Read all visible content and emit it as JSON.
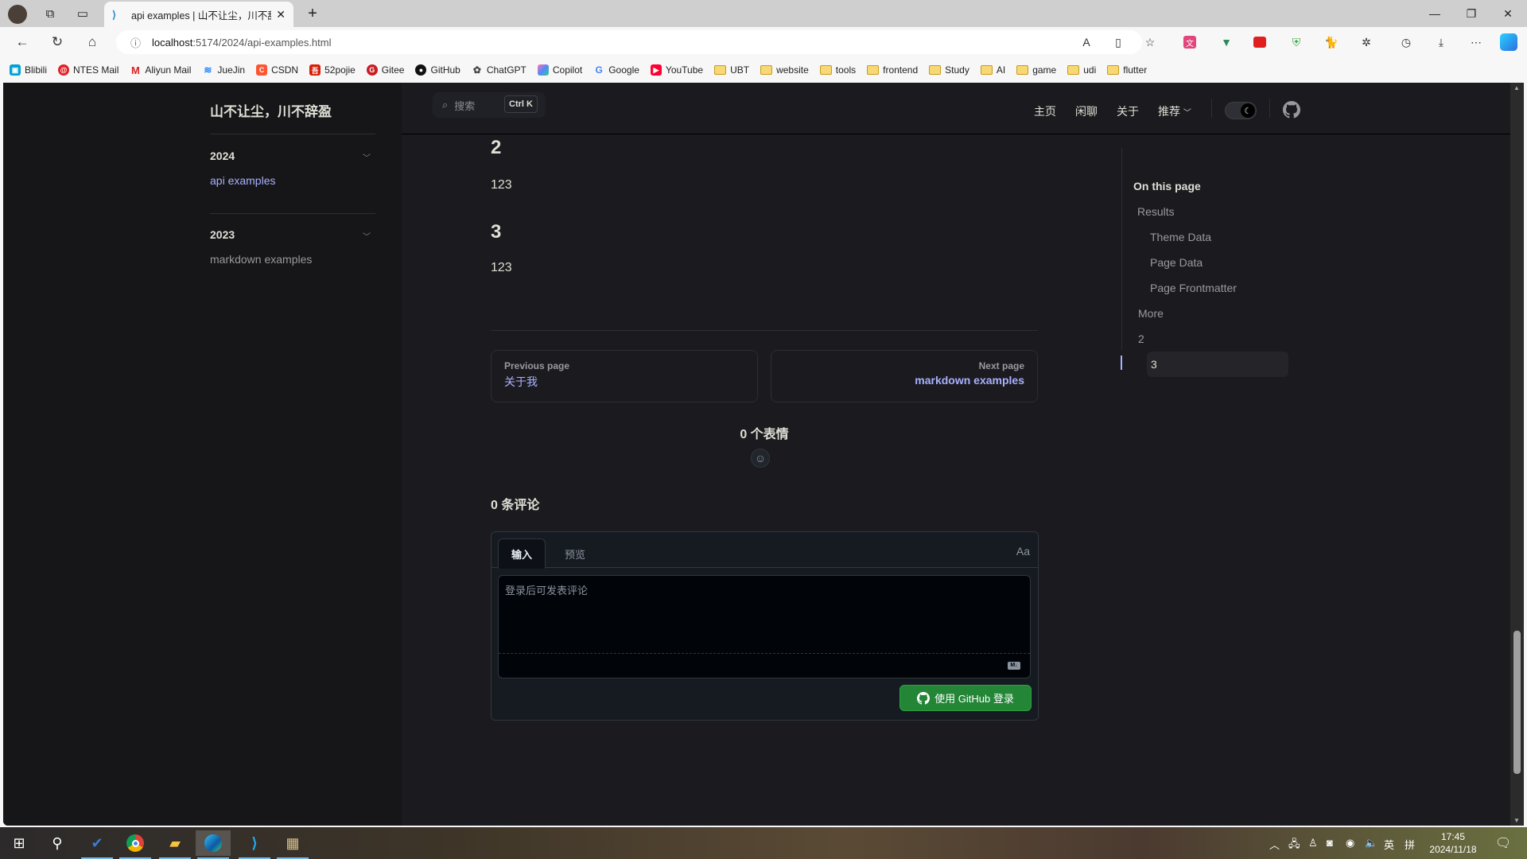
{
  "browser": {
    "tab_title": "api examples | 山不让尘，川不辞盈",
    "new_tab_symbol": "+",
    "url_host": "localhost",
    "url_path": ":5174/2024/api-examples.html",
    "bookmarks": [
      {
        "label": "Blibili",
        "icon": "bilibili-icon",
        "color": "#00a1d6"
      },
      {
        "label": "NTES Mail",
        "icon": "netease-mail-icon",
        "color": "#e31e24"
      },
      {
        "label": "Aliyun Mail",
        "icon": "aliyun-mail-icon",
        "color": "#e02020"
      },
      {
        "label": "JueJin",
        "icon": "juejin-icon",
        "color": "#1e80ff"
      },
      {
        "label": "CSDN",
        "icon": "csdn-icon",
        "color": "#fc5531"
      },
      {
        "label": "52pojie",
        "icon": "52pojie-icon",
        "color": "#d81e06"
      },
      {
        "label": "Gitee",
        "icon": "gitee-icon",
        "color": "#c71d23"
      },
      {
        "label": "GitHub",
        "icon": "github-icon",
        "color": "#111111"
      },
      {
        "label": "ChatGPT",
        "icon": "chatgpt-icon",
        "color": "#444444"
      },
      {
        "label": "Copilot",
        "icon": "copilot-icon",
        "color": "#6b5bd6"
      },
      {
        "label": "Google",
        "icon": "google-icon",
        "color": "#4285f4"
      },
      {
        "label": "YouTube",
        "icon": "youtube-icon",
        "color": "#ff0033"
      }
    ],
    "bookmark_folders": [
      "UBT",
      "website",
      "tools",
      "frontend",
      "Study",
      "AI",
      "game",
      "udi",
      "flutter"
    ]
  },
  "site": {
    "title": "山不让尘，川不辞盈",
    "search_placeholder": "搜索",
    "search_shortcut": "Ctrl K",
    "nav": [
      "主页",
      "闲聊",
      "关于",
      "推荐"
    ],
    "nav_dropdown_index": 3
  },
  "sidebar": {
    "groups": [
      {
        "label": "2024",
        "items": [
          {
            "label": "api examples",
            "active": true
          }
        ]
      },
      {
        "label": "2023",
        "items": [
          {
            "label": "markdown examples",
            "active": false
          }
        ]
      }
    ]
  },
  "content": {
    "sections": [
      {
        "heading": "2",
        "text": "123"
      },
      {
        "heading": "3",
        "text": "123"
      }
    ],
    "prev": {
      "label": "Previous page",
      "title": "关于我"
    },
    "next": {
      "label": "Next page",
      "title": "markdown examples"
    }
  },
  "giscus": {
    "reactions_label": "0 个表情",
    "comments_label": "0 条评论",
    "tab_input": "输入",
    "tab_preview": "预览",
    "format_toggle": "Aa",
    "placeholder": "登录后可发表评论",
    "markdown_badge": "M↓",
    "login_button": "使用 GitHub 登录"
  },
  "toc": {
    "title": "On this page",
    "items": [
      {
        "label": "Results",
        "level": 1
      },
      {
        "label": "Theme Data",
        "level": 2
      },
      {
        "label": "Page Data",
        "level": 2
      },
      {
        "label": "Page Frontmatter",
        "level": 2
      },
      {
        "label": "More",
        "level": 1
      },
      {
        "label": "2",
        "level": 1
      },
      {
        "label": "3",
        "level": 2,
        "active": true
      }
    ]
  },
  "scroll": {
    "position_fraction": 0.93
  },
  "taskbar": {
    "time": "17:45",
    "date": "2024/11/18",
    "ime_lang": "英",
    "ime_mode": "拼"
  },
  "colors": {
    "brand": "#a8b1ff",
    "bg": "#1b1b1f",
    "sidebar_bg": "#161618",
    "github_green": "#238636"
  }
}
